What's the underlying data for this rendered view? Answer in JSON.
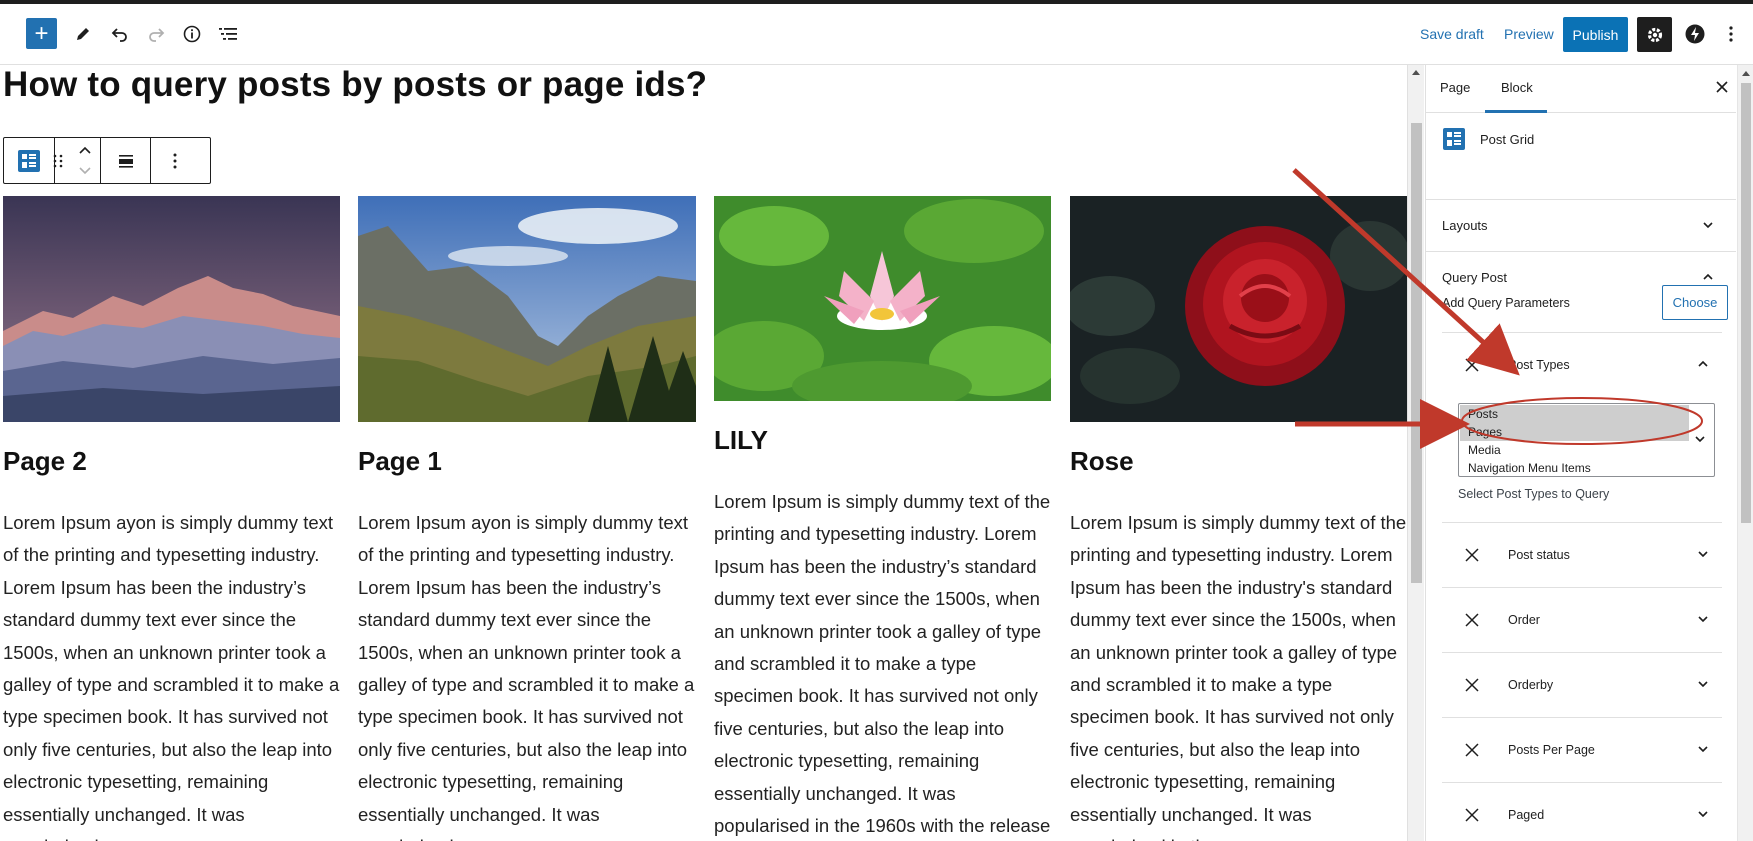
{
  "toolbar": {
    "save_draft": "Save draft",
    "preview": "Preview",
    "publish": "Publish",
    "add_symbol": "+"
  },
  "post": {
    "title": "How to query posts by posts or page ids?"
  },
  "cards": [
    {
      "title": "Page 2",
      "body": "Lorem Ipsum ayon is simply dummy text of the printing and typesetting industry. Lorem Ipsum has been the industry’s standard dummy text ever since the 1500s, when an unknown printer took a galley of type and scrambled it to make a type specimen book. It has survived not only five centuries, but also the leap into electronic typesetting, remaining essentially unchanged. It was popularised"
    },
    {
      "title": "Page 1",
      "body": "Lorem Ipsum ayon is simply dummy text of the printing and typesetting industry. Lorem Ipsum has been the industry’s standard dummy text ever since the 1500s, when an unknown printer took a galley of type and scrambled it to make a type specimen book. It has survived not only five centuries, but also the leap into electronic typesetting, remaining essentially unchanged. It was popularised"
    },
    {
      "title": "LILY",
      "body": "Lorem Ipsum is simply dummy text of the printing and typesetting industry. Lorem Ipsum has been the industry’s standard dummy text ever since the 1500s, when an unknown printer took a galley of type and scrambled it to make a type specimen book. It has survived not only five centuries, but also the leap into electronic typesetting, remaining essentially unchanged. It was popularised in the 1960s with the release of Letraset sheets"
    },
    {
      "title": "Rose",
      "body": "Lorem Ipsum is simply dummy text of the printing and typesetting industry. Lorem Ipsum has been the industry's standard dummy text ever since the 1500s, when an unknown printer took a galley of type and scrambled it to make a type specimen book. It has survived not only five centuries, but also the leap into electronic typesetting, remaining essentially unchanged. It was popularised in the"
    }
  ],
  "sidebar": {
    "tabs": [
      "Page",
      "Block"
    ],
    "block_name": "Post Grid",
    "panels": {
      "layouts": "Layouts",
      "query_post": "Query Post"
    },
    "add_query_parameters": "Add Query Parameters",
    "choose": "Choose",
    "post_types_label": "Post Types",
    "post_type_options": [
      "Posts",
      "Pages",
      "Media",
      "Navigation Menu Items"
    ],
    "selected_options": [
      "Posts",
      "Pages"
    ],
    "select_help": "Select Post Types to Query",
    "params": [
      "Post status",
      "Order",
      "Orderby",
      "Posts Per Page",
      "Paged"
    ]
  },
  "colors": {
    "accent": "#2271b1",
    "annotation": "#c0392b"
  },
  "icons": [
    "plus-icon",
    "pencil-icon",
    "undo-icon",
    "redo-icon",
    "info-icon",
    "list-view-icon",
    "gear-icon",
    "jetpack-icon",
    "more-vertical-icon",
    "grid-block-icon",
    "drag-handle-icon",
    "move-up-icon",
    "move-down-icon",
    "align-icon",
    "close-icon",
    "chevron-down-icon",
    "chevron-up-icon",
    "remove-x-icon"
  ]
}
